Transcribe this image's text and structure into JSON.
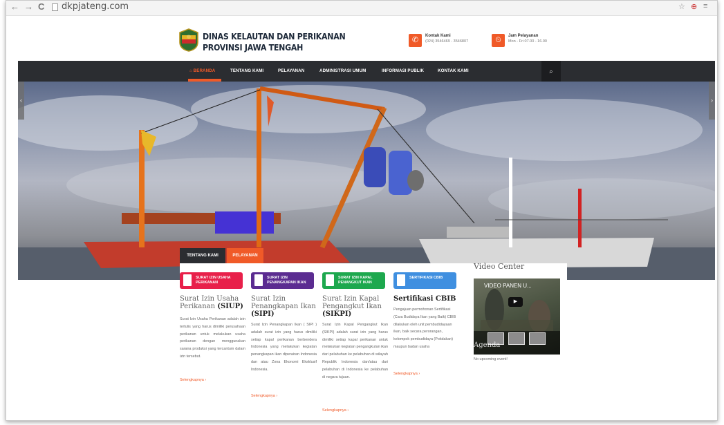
{
  "browser": {
    "back": "←",
    "forward": "→",
    "reload": "C",
    "url": "dkpjateng.com",
    "right_icons": [
      "☆",
      "⊕",
      "≡"
    ]
  },
  "header": {
    "title_line1": "DINAS KELAUTAN DAN PERIKANAN",
    "title_line2": "PROVINSI JAWA TENGAH",
    "contact_label": "Kontak Kami",
    "contact_value": "(024) 3546469 - 3546807",
    "hours_label": "Jam Pelayanan",
    "hours_value": "Mon - Fri 07.00 - 16.00",
    "accent": "#f05a28"
  },
  "nav": {
    "items": [
      "⌂ BERANDA",
      "TENTANG KAMI",
      "PELAYANAN",
      "ADMINISTRASI UMUM",
      "INFORMASI PUBLIK",
      "KONTAK KAMI"
    ],
    "active_index": 0,
    "search_icon": "search-icon"
  },
  "tabs": {
    "items": [
      "TENTANG KAMI",
      "PELAYANAN"
    ],
    "active_index": 1
  },
  "services": [
    {
      "badge": "SURAT IZIN USAHA PERIKANAN",
      "badge_color": "#e8204a",
      "title": "Surat Izin Usaha Perikanan",
      "abbr": "(SIUP)",
      "body": "Surat Izin Usaha Perikanan adalah izin tertulis yang harus dimiliki perusahaan perikanan untuk melakukan usaha perikanan dengan menggunakan sarana produksi yang tercantum dalam izin tersebut.",
      "more": "Selengkapnya ›"
    },
    {
      "badge": "SURAT IZIN PENANGKAPAN IKAN",
      "badge_color": "#5b2c91",
      "title": "Surat Izin Penangkapan Ikan",
      "abbr": "(SIPI)",
      "body": "Surat Izin Penangkapan Ikan ( SIPI ) adalah surat izin yang harus dimiliki setiap kapal perikanan berbendera Indonesia yang melakukan kegiatan penangkapan ikan diperairan Indonesia dan atau Zona Ekonomi Eksklusif Indonesia.",
      "more": "Selengkapnya ›"
    },
    {
      "badge": "SURAT IZIN KAPAL PENANGKUT IKAN",
      "badge_color": "#1da84e",
      "title": "Surat Izin Kapal Pengangkut Ikan",
      "abbr": "(SIKPI)",
      "body": "Surat Izin Kapal Pengangkut Ikan (SIKPI) adalah surat izin yang harus dimiliki setiap kapal perikanan untuk melakukan kegiatan pengangkutan ikan dari pelabuhan ke pelabuhan di wilayah Republik Indonesia dan/atau dari pelabuhan di Indonesia ke pelabuhan di negara tujuan.",
      "more": "Selengkapnya ›"
    },
    {
      "badge": "SERTIFIKASI CBIB",
      "badge_color": "#3f8fe0",
      "title": "Sertifikasi CBIB",
      "abbr": "",
      "body": "Pengajuan permohonan Sertifikasi (Cara Budidaya Ikan yang Baik) CBIB dilakukan oleh unit pembudidayaan ikan, baik secara perorangan, kelompok pembudidaya (Pokdakan) maupun badan usaha",
      "more": "Selengkapnya ›"
    }
  ],
  "sidebar": {
    "video_heading": "Video Center",
    "video_title": "VIDEO PANEN U...",
    "agenda_heading": "Agenda",
    "no_event": "No upcoming event!"
  }
}
